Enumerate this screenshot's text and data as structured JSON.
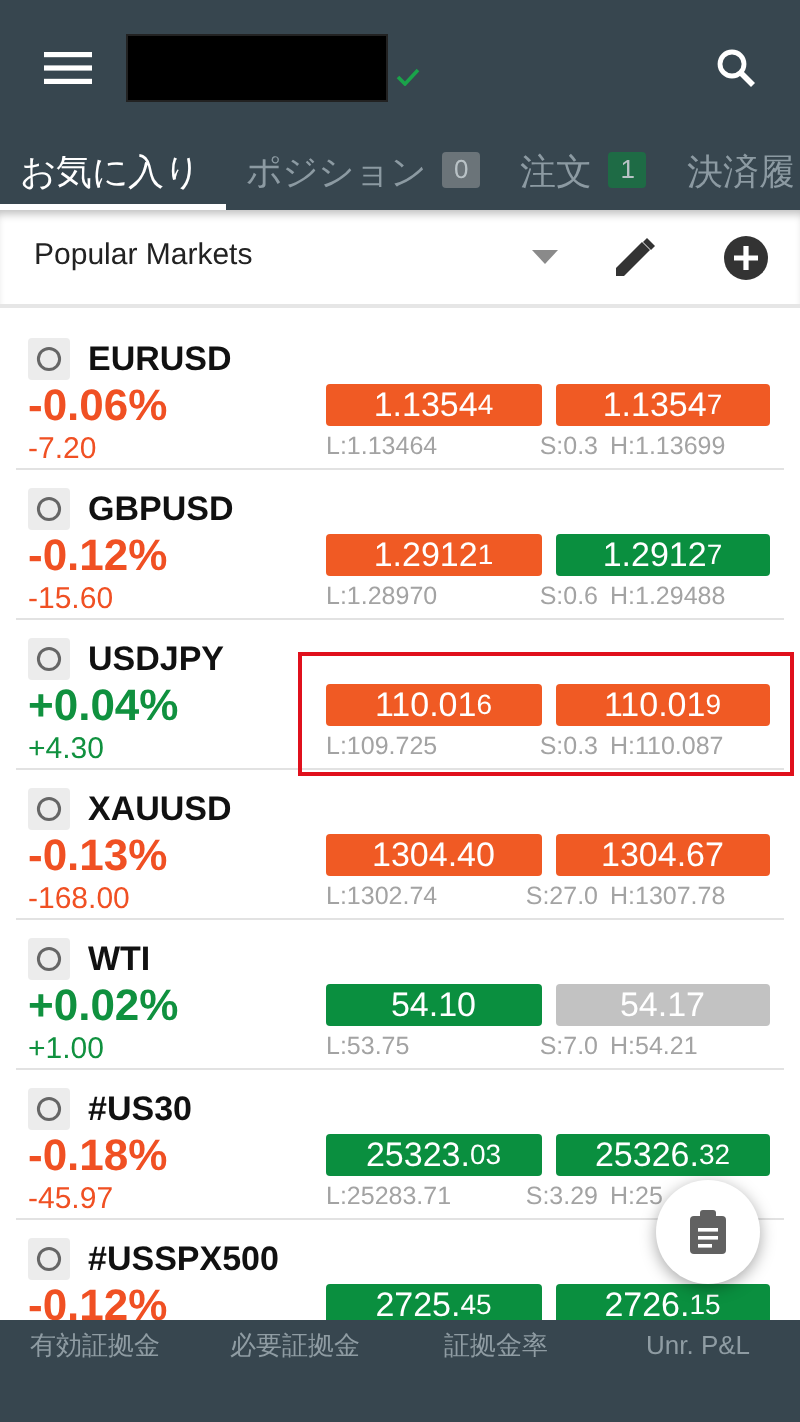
{
  "tabs": [
    {
      "label": "お気に入り",
      "selected": true
    },
    {
      "label": "ポジション",
      "selected": false,
      "badge": "0",
      "color": "#6b7479"
    },
    {
      "label": "注文",
      "selected": false,
      "badge": "1",
      "color": "#1e6b45"
    },
    {
      "label": "決済履",
      "selected": false
    }
  ],
  "list_header": {
    "title": "Popular Markets"
  },
  "markets": [
    {
      "symbol": "EURUSD",
      "color": "#f05023",
      "percent": "-0.06%",
      "change": "-7.20",
      "highlighted": false,
      "bid": {
        "main": "1.1354",
        "pip": "4",
        "color": "#f05a24"
      },
      "ask": {
        "main": "1.1354",
        "pip": "7",
        "color": "#f05a24"
      },
      "low": "L:1.13464",
      "spread": "S:0.3",
      "high": "H:1.13699"
    },
    {
      "symbol": "GBPUSD",
      "color": "#f05023",
      "percent": "-0.12%",
      "change": "-15.60",
      "highlighted": false,
      "bid": {
        "main": "1.2912",
        "pip": "1",
        "color": "#f05a24"
      },
      "ask": {
        "main": "1.2912",
        "pip": "7",
        "color": "#0a8f3f"
      },
      "low": "L:1.28970",
      "spread": "S:0.6",
      "high": "H:1.29488"
    },
    {
      "symbol": "USDJPY",
      "color": "#10913f",
      "percent": "+0.04%",
      "change": "+4.30",
      "highlighted": true,
      "bid": {
        "main": "110.01",
        "pip": "6",
        "color": "#f05a24"
      },
      "ask": {
        "main": "110.01",
        "pip": "9",
        "color": "#f05a24"
      },
      "low": "L:109.725",
      "spread": "S:0.3",
      "high": "H:110.087"
    },
    {
      "symbol": "XAUUSD",
      "color": "#f05023",
      "percent": "-0.13%",
      "change": "-168.00",
      "highlighted": false,
      "bid": {
        "main": "1304.40",
        "color": "#f05a24"
      },
      "ask": {
        "main": "1304.67",
        "color": "#f05a24"
      },
      "low": "L:1302.74",
      "spread": "S:27.0",
      "high": "H:1307.78"
    },
    {
      "symbol": "WTI",
      "color": "#10913f",
      "percent": "+0.02%",
      "change": "+1.00",
      "highlighted": false,
      "bid": {
        "main": "54.10",
        "color": "#0a8f3f"
      },
      "ask": {
        "main": "54.17",
        "color": "#c2c2c2"
      },
      "low": "L:53.75",
      "spread": "S:7.0",
      "high": "H:54.21"
    },
    {
      "symbol": "#US30",
      "color": "#f05023",
      "percent": "-0.18%",
      "change": "-45.97",
      "highlighted": false,
      "bid": {
        "main": "25323.",
        "pip": "03",
        "color": "#0a8f3f"
      },
      "ask": {
        "main": "25326.",
        "pip": "32",
        "color": "#0a8f3f"
      },
      "low": "L:25283.71",
      "spread": "S:3.29",
      "high": "H:25"
    },
    {
      "symbol": "#USSPX500",
      "color": "#f05023",
      "percent": "-0.12%",
      "highlighted": false,
      "bid": {
        "main": "2725.",
        "pip": "45",
        "color": "#0a8f3f"
      },
      "ask": {
        "main": "2726.",
        "pip": "15",
        "color": "#0a8f3f"
      }
    }
  ],
  "footer": [
    "有効証拠金",
    "必要証拠金",
    "証拠金率",
    "Unr. P&L"
  ]
}
